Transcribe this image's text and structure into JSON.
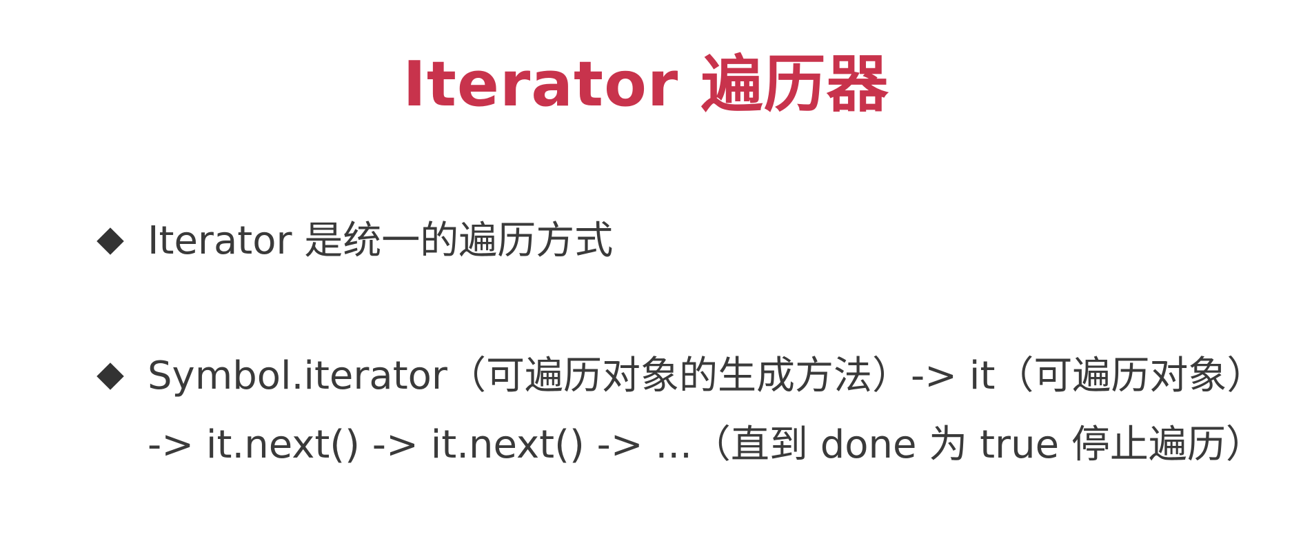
{
  "slide": {
    "title": "Iterator 遍历器",
    "bullets": [
      {
        "lines": [
          "Iterator 是统一的遍历方式"
        ]
      },
      {
        "lines": [
          "Symbol.iterator（可遍历对象的生成方法）-> it（可遍历对象）",
          "-> it.next() -> it.next() -> ...（直到 done 为 true 停止遍历）"
        ]
      }
    ]
  },
  "colors": {
    "title": "#c8334c",
    "text": "#3a3a3a",
    "bullet_marker": "#333333",
    "background": "#ffffff"
  },
  "icons": {
    "bullet_marker": "diamond-bullet-icon"
  }
}
